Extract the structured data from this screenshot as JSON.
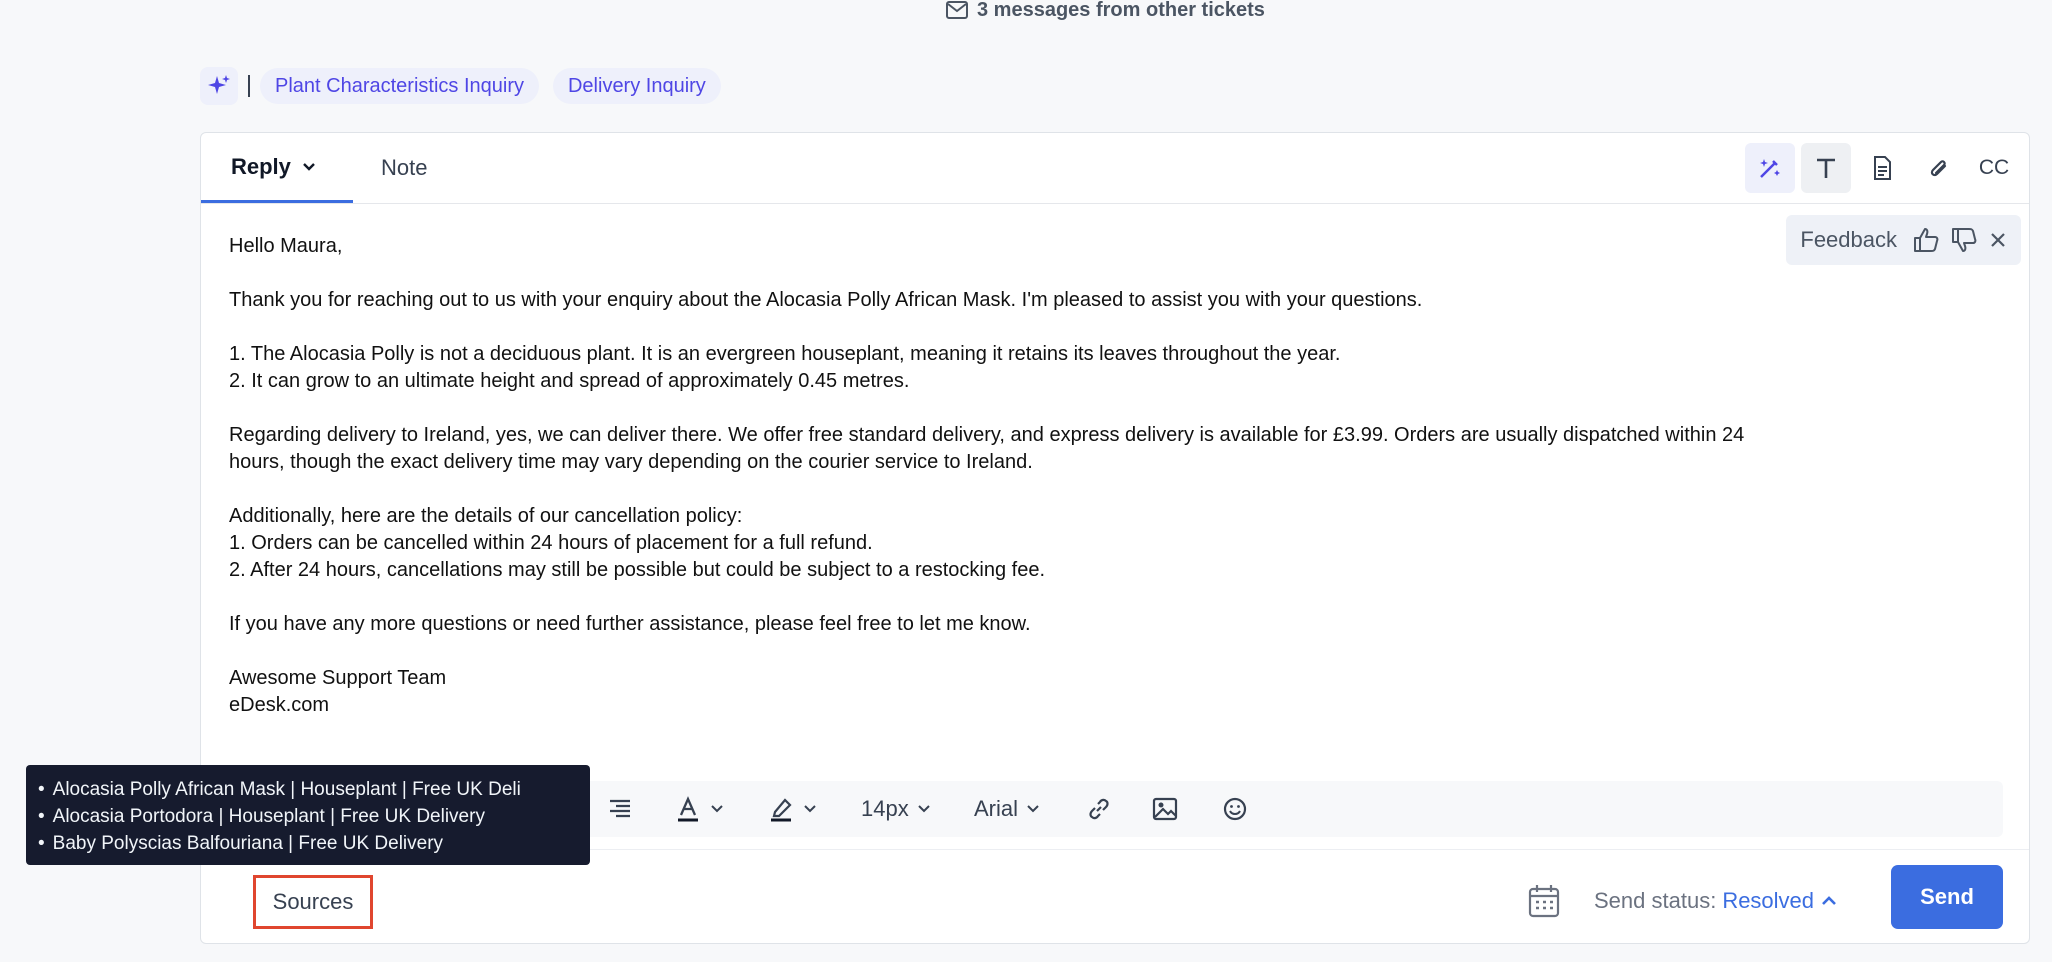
{
  "header": {
    "other_messages": "3 messages from other tickets"
  },
  "tags": [
    {
      "label": "Plant Characteristics Inquiry"
    },
    {
      "label": "Delivery Inquiry"
    }
  ],
  "tabs": {
    "reply": "Reply",
    "note": "Note"
  },
  "toolbar_top": {
    "cc": "CC"
  },
  "feedback": {
    "label": "Feedback"
  },
  "message": {
    "greeting": "Hello Maura,",
    "intro": "Thank you for reaching out to us with your enquiry about the Alocasia Polly African Mask. I'm pleased to assist you with your questions.",
    "point1": "1. The Alocasia Polly is not a deciduous plant. It is an evergreen houseplant, meaning it retains its leaves throughout the year.",
    "point2": "2. It can grow to an ultimate height and spread of approximately 0.45 metres.",
    "delivery_line1": "Regarding delivery to Ireland, yes, we can deliver there. We offer free standard delivery, and express delivery is available for £3.99. Orders are usually dispatched within 24",
    "delivery_line2": "hours, though the exact delivery time may vary depending on the courier service to Ireland.",
    "policy_intro": "Additionally, here are the details of our cancellation policy:",
    "policy1": "1. Orders can be cancelled within 24 hours of placement for a full refund.",
    "policy2": "2. After 24 hours, cancellations may still be possible but could be subject to a restocking fee.",
    "closing": "If you have any more questions or need further assistance, please feel free to let me know.",
    "signature_team": "Awesome Support Team",
    "signature_site": "eDesk.com"
  },
  "format_toolbar": {
    "font_size": "14px",
    "font_family": "Arial"
  },
  "sources": {
    "button_label": "Sources",
    "items": [
      "Alocasia Polly African Mask | Houseplant | Free UK Deli",
      "Alocasia Portodora | Houseplant | Free UK Delivery",
      "Baby Polyscias Balfouriana | Free UK Delivery"
    ]
  },
  "footer": {
    "send_status_label": "Send status:",
    "send_status_value": "Resolved",
    "send_label": "Send"
  },
  "colors": {
    "accent": "#3b6de0",
    "tag_text": "#4f46e5",
    "highlight_border": "#e0462f",
    "tooltip_bg": "#161b2e"
  }
}
